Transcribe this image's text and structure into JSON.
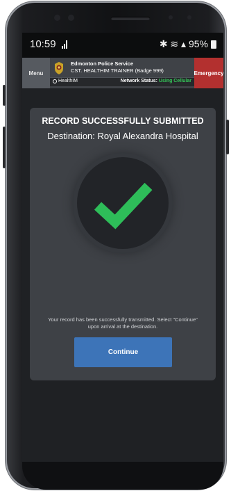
{
  "status_bar": {
    "time": "10:59",
    "right_text": "✱ ≋ ▴ 95%"
  },
  "app_header": {
    "menu_label": "Menu",
    "agency": "Edmonton Police Service",
    "officer": "CST. HEALTHIM TRAINER (Badge 999)",
    "emergency_label": "Emergency",
    "app_name": "HealthIM",
    "network_label": "Network Status:",
    "network_status": "Using Cellular"
  },
  "confirmation": {
    "title": "RECORD SUCCESSFULLY SUBMITTED",
    "destination": "Destination: Royal Alexandra Hospital",
    "message": "Your record has been successfully transmitted. Select \"Continue\" upon arrival at the destination.",
    "continue_label": "Continue",
    "success_icon": "checkmark-icon"
  },
  "colors": {
    "accent": "#3d74b8",
    "success": "#2ebd59",
    "emergency": "#b3302f",
    "network_ok": "#35c759"
  }
}
